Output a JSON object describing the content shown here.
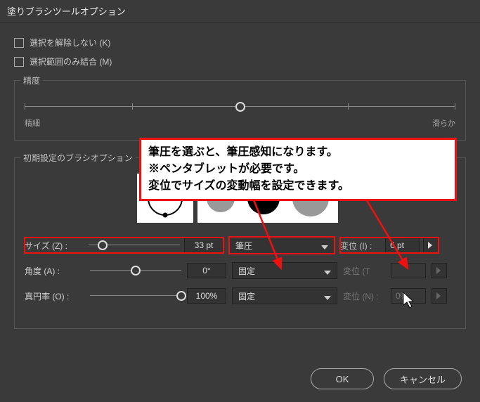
{
  "title": "塗りブラシツールオプション",
  "checkbox1": "選択を解除しない (K)",
  "checkbox2": "選択範囲のみ結合 (M)",
  "precision": {
    "legend": "精度",
    "min": "精細",
    "max": "滑らか"
  },
  "brush": {
    "legend": "初期設定のブラシオプション"
  },
  "rows": {
    "size": {
      "label": "サイズ (Z) :",
      "value": "33 pt",
      "select": "筆圧",
      "right_label": "変位 (I) :",
      "right_value": "6 pt"
    },
    "angle": {
      "label": "角度 (A) :",
      "value": "0°",
      "select": "固定",
      "right_label": "変位 (T",
      "right_value": ""
    },
    "round": {
      "label": "真円率 (O) :",
      "value": "100%",
      "select": "固定",
      "right_label": "変位 (N) :",
      "right_value": "0%"
    }
  },
  "annotation": {
    "line1": "筆圧を選ぶと、筆圧感知になります。",
    "line2": "※ペンタブレットが必要です。",
    "line3": "変位でサイズの変動幅を設定できます。"
  },
  "buttons": {
    "ok": "OK",
    "cancel": "キャンセル"
  }
}
